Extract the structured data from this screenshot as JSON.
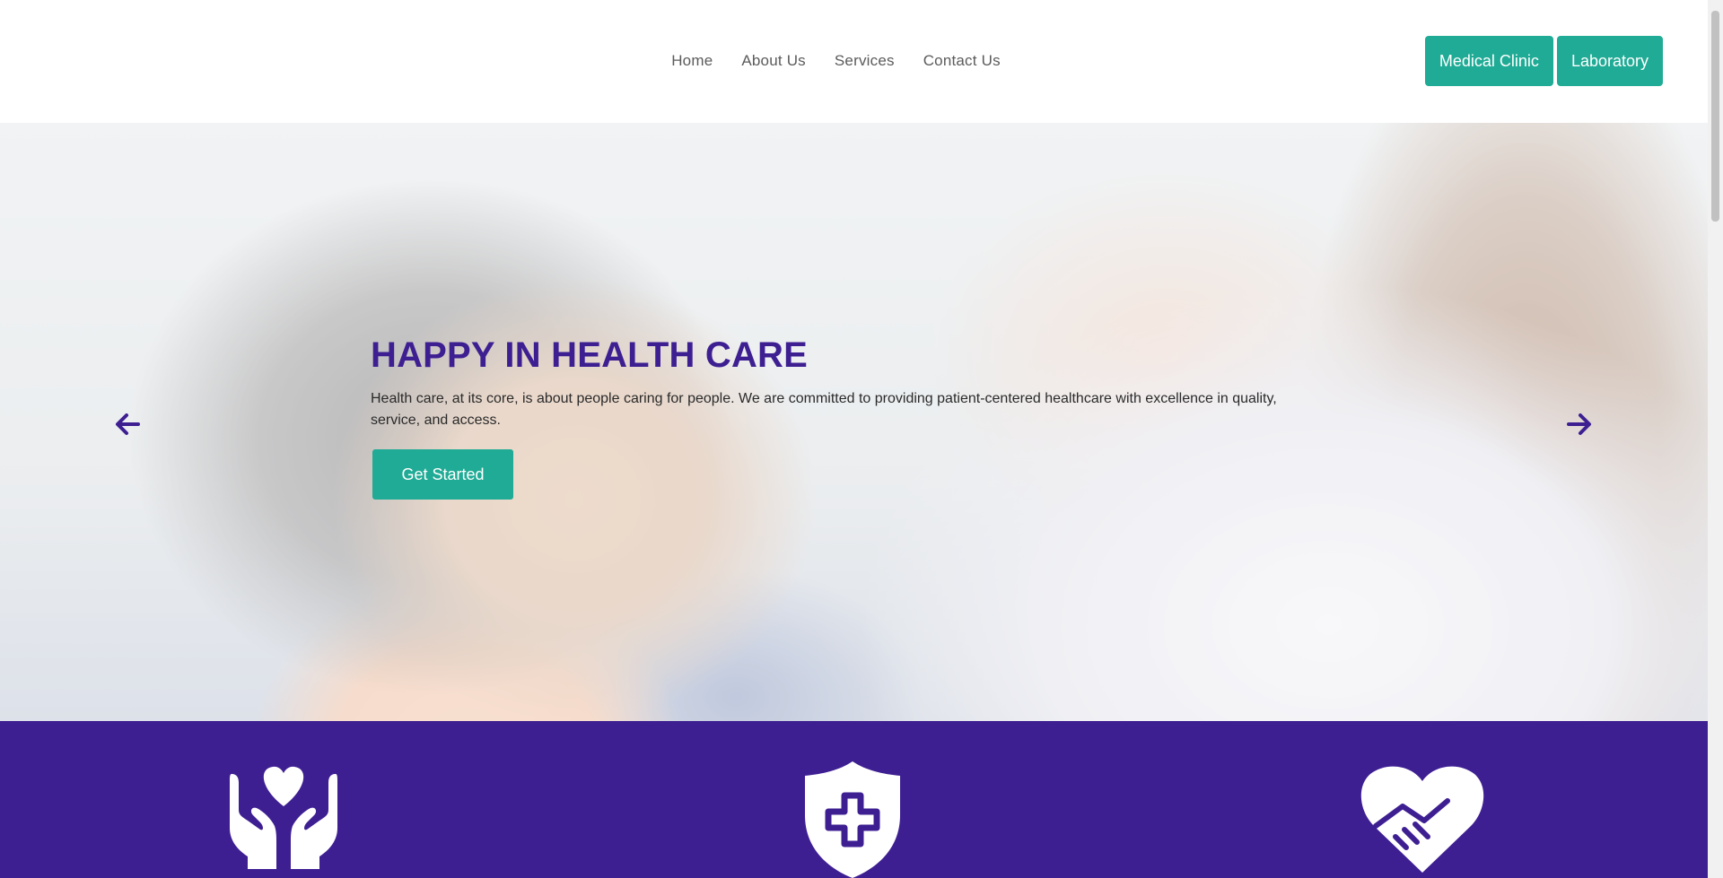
{
  "nav": {
    "items": [
      {
        "label": "Home"
      },
      {
        "label": "About Us"
      },
      {
        "label": "Services"
      },
      {
        "label": "Contact Us"
      }
    ]
  },
  "header_buttons": {
    "medical_clinic": "Medical Clinic",
    "laboratory": "Laboratory"
  },
  "hero": {
    "title": "HAPPY IN HEALTH CARE",
    "text": "Health care, at its core, is about people caring for people. We are committed to providing patient-centered healthcare with excellence in quality, service, and access.",
    "cta": "Get Started"
  },
  "features": {
    "icons": [
      "hands-heart-icon",
      "shield-plus-icon",
      "handshake-heart-icon"
    ]
  },
  "colors": {
    "brand_purple": "#3e1f92",
    "accent_teal": "#1fab95"
  }
}
